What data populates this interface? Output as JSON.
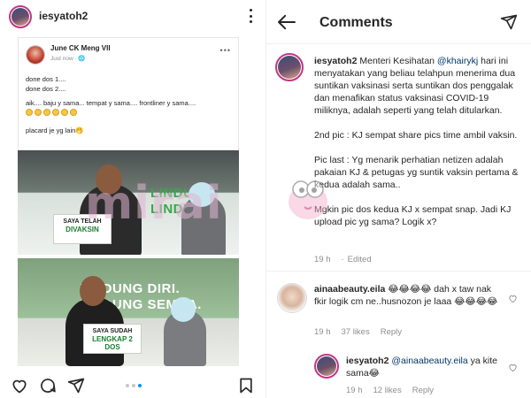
{
  "post": {
    "username": "iesyatoh2",
    "fb_screenshot": {
      "name": "June CK Meng VII",
      "meta": "Just now · 🌐",
      "lines": [
        "done dos 1....",
        "done dos 2....",
        "aik.... baju y sama... tempat y sama.... frontliner y sama....",
        "placard je yg lain🤭"
      ]
    },
    "photo1": {
      "banner": "LINDUNG",
      "banner2": "LINDUNG",
      "sign_line1": "SAYA TELAH",
      "sign_line2": "DIVAKSIN"
    },
    "photo2": {
      "banner": "LINDUNG DIRI.",
      "banner2": "LINDUNG SEMUA.",
      "sign_line1": "SAYA SUDAH",
      "sign_line2": "LENGKAP 2 DOS"
    }
  },
  "comments_panel": {
    "title": "Comments",
    "caption": {
      "username": "iesyatoh2",
      "text_before_mention": " Menteri Kesihatan ",
      "mention": "@khairykj",
      "text_after_mention": " hari ini menyatakan yang beliau telahpun menerima dua suntikan vaksinasi serta suntikan dos penggalak dan menafikan status vaksinasi COVID-19 miliknya, adalah seperti yang telah ditularkan.",
      "para2": "2nd pic : KJ sempat share pics time ambil vaksin.",
      "para3": "Pic last : Yg menarik perhatian netizen adalah pakaian KJ & petugas yg suntik vaksin pertama & kedua adalah sama..",
      "para4": "Mgkin pic dos kedua KJ x sempat snap. Jadi KJ upload pic yg sama? Logik x?",
      "time": "19 h",
      "edited": "Edited"
    },
    "watermark": "mirai",
    "comments": [
      {
        "username": "ainaabeauty.eila",
        "text": " 😂😂😂😂 dah x taw nak fkir logik cm ne..husnozon je laaa 😂😂😂😂",
        "time": "19 h",
        "likes": "37 likes",
        "reply": "Reply"
      },
      {
        "username": "iesyatoh2",
        "mention": "@ainaabeauty.eila",
        "text": " ya kite sama😂",
        "time": "19 h",
        "likes": "12 likes",
        "reply": "Reply"
      }
    ]
  },
  "colors": {
    "accent_blue": "#0095f6",
    "mention": "#00376b",
    "muted": "#8e8e8e",
    "banner_green": "#3aa64a"
  },
  "icons": [
    "more-icon",
    "heart-icon",
    "comment-icon",
    "share-icon",
    "bookmark-icon",
    "back-arrow-icon",
    "send-icon"
  ]
}
